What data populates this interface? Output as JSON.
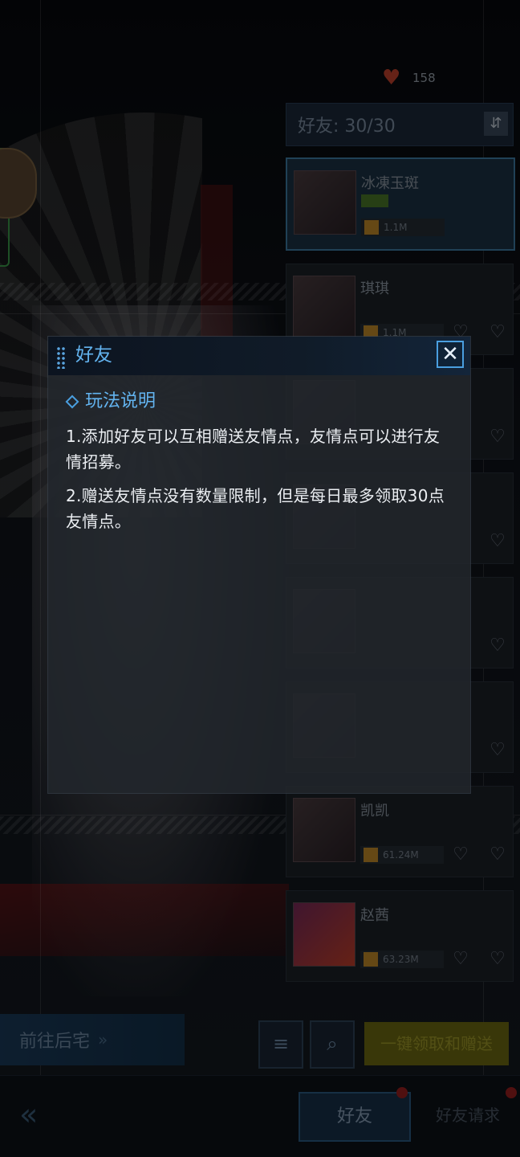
{
  "top": {
    "currency_icon": "heart-icon",
    "currency_value": "158"
  },
  "friend_panel": {
    "header_label": "好友: 30/30",
    "header_button": "⇵",
    "rows": [
      {
        "name": "冰凍玉斑",
        "level": "1.1M"
      },
      {
        "name": "琪琪",
        "level": "1.1M"
      },
      {
        "name": "",
        "level": ""
      },
      {
        "name": "",
        "level": ""
      },
      {
        "name": "",
        "level": ""
      },
      {
        "name": "",
        "level": ""
      },
      {
        "name": "凯凯",
        "level": "61.24M"
      },
      {
        "name": "赵茜",
        "level": "63.23M"
      }
    ]
  },
  "bottom": {
    "goto_home": "前往后宅",
    "claim_all": "一键领取和赠送",
    "tab_friends": "好友",
    "tab_requests": "好友请求"
  },
  "modal": {
    "title": "好友",
    "close_glyph": "✕",
    "section_title": "玩法说明",
    "rules": [
      "1.添加好友可以互相赠送友情点，友情点可以进行友情招募。",
      "2.赠送友情点没有数量限制，但是每日最多领取30点友情点。"
    ]
  },
  "colors": {
    "accent": "#63b4f0",
    "close_border": "#4a9fe0"
  }
}
